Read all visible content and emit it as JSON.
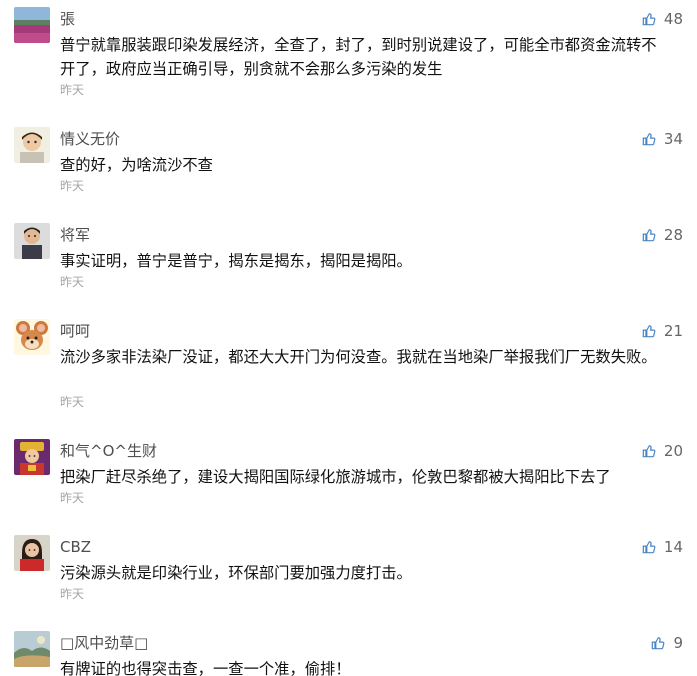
{
  "comments": [
    {
      "username": "張",
      "text": "普宁就靠服装跟印染发展经济，全查了，封了，到时别说建设了，可能全市都资金流转不开了，政府应当正确引导，别贪就不会那么多污染的发生",
      "time": "昨天",
      "likes": "48",
      "avatar": "landscape-purple-field"
    },
    {
      "username": "情义无价",
      "text": "查的好，为啥流沙不查",
      "time": "昨天",
      "likes": "34",
      "avatar": "child-photo"
    },
    {
      "username": "将军",
      "text": "事实证明，普宁是普宁，揭东是揭东，揭阳是揭阳。",
      "time": "昨天",
      "likes": "28",
      "avatar": "man-photo"
    },
    {
      "username": "呵呵",
      "text": "流沙多家非法染厂没证，都还大大开门为何没查。我就在当地染厂举报我们厂无数失败。",
      "time": "昨天",
      "likes": "21",
      "avatar": "cartoon-mouse"
    },
    {
      "username": "和气^O^生财",
      "text": "把染厂赶尽杀绝了，建设大揭阳国际绿化旅游城市，伦敦巴黎都被大揭阳比下去了",
      "time": "昨天",
      "likes": "20",
      "avatar": "wealth-god"
    },
    {
      "username": "CBZ",
      "text": "污染源头就是印染行业，环保部门要加强力度打击。",
      "time": "昨天",
      "likes": "14",
      "avatar": "woman-red-photo"
    },
    {
      "username": "□风中劲草□",
      "text": "有牌证的也得突击查，一查一个准，偷排！",
      "time": "",
      "likes": "9",
      "avatar": "painting-landscape"
    }
  ],
  "colors": {
    "username": "#4f4f4f",
    "text": "#111111",
    "timestamp": "#a6a6a6",
    "like_icon": "#4a86c5",
    "like_count": "#666666"
  },
  "icons": {
    "like": "thumbs-up-icon"
  }
}
